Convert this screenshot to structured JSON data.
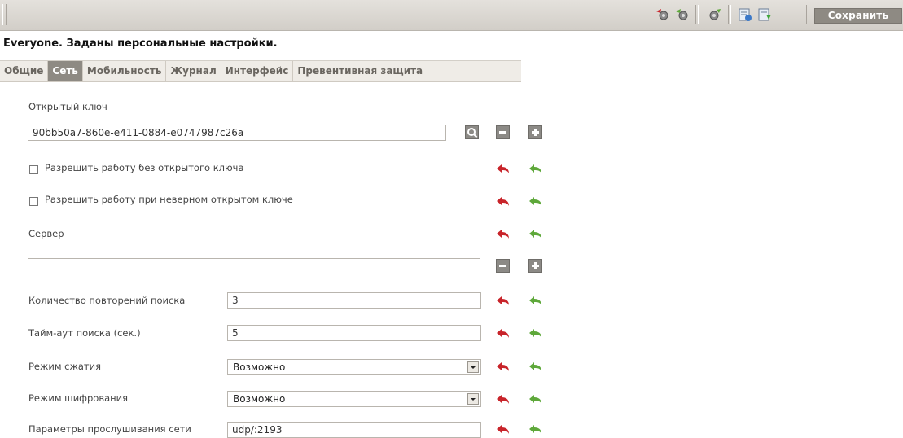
{
  "toolbar": {
    "save_label": "Сохранить",
    "icons": [
      "gear-red-icon",
      "gear-green-icon",
      "gear-single-icon",
      "export-icon",
      "import-icon"
    ]
  },
  "heading": "Everyone. Заданы персональные настройки.",
  "tabs": [
    {
      "label": "Общие",
      "active": false
    },
    {
      "label": "Сеть",
      "active": true
    },
    {
      "label": "Мобильность",
      "active": false
    },
    {
      "label": "Журнал",
      "active": false
    },
    {
      "label": "Интерфейс",
      "active": false
    },
    {
      "label": "Превентивная защита",
      "active": false
    }
  ],
  "form": {
    "public_key_label": "Открытый ключ",
    "public_key_value": "90bb50a7-860e-e411-0884-e0747987c26a",
    "allow_without_key_label": "Разрешить работу без открытого ключа",
    "allow_wrong_key_label": "Разрешить работу при неверном открытом ключе",
    "server_label": "Сервер",
    "server_value": "",
    "search_retries_label": "Количество повторений поиска",
    "search_retries_value": "3",
    "search_timeout_label": "Тайм-аут поиска (сек.)",
    "search_timeout_value": "5",
    "compression_label": "Режим сжатия",
    "compression_value": "Возможно",
    "encryption_label": "Режим шифрования",
    "encryption_value": "Возможно",
    "listen_label": "Параметры прослушивания сети",
    "listen_value": "udp/:2193"
  },
  "colors": {
    "toolbar_bg": "#d8d4ce",
    "active_tab": "#8e8a83",
    "reset_red": "#c8242a",
    "reset_green": "#5ea83a"
  }
}
